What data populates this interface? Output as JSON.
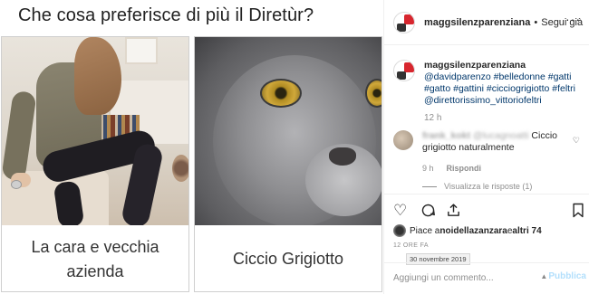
{
  "post": {
    "question": "Che cosa preferisce di più il Diretùr?",
    "options": [
      {
        "label": "La cara e vecchia azienda"
      },
      {
        "label": "Ciccio Grigiotto"
      }
    ]
  },
  "panel": {
    "header": {
      "username": "maggsilenzparenziana",
      "separator": "•",
      "follow_status": "Segui già",
      "more_icon": "more-horizontal-icon"
    },
    "caption": {
      "username": "maggsilenzparenziana",
      "tags": "@davidparenzo #belledonne #gatti #gatto #gattini #cicciogrigiotto #feltri @direttorissimo_vittoriofeltri",
      "time": "12 h"
    },
    "comment": {
      "username": "frank_kokt",
      "mention": "@lucagnoatti",
      "text": "Ciccio grigiotto naturalmente",
      "time": "9 h",
      "reply_label": "Rispondi",
      "view_replies": "Visualizza le risposte (1)",
      "like_icon": "heart-outline-icon"
    },
    "actions": {
      "like_icon": "heart-outline-icon",
      "comment_icon": "comment-bubble-icon",
      "share_icon": "share-icon",
      "save_icon": "bookmark-icon"
    },
    "likes": {
      "prefix": "Piace a ",
      "user": "noidellazanzara",
      "middle": " e ",
      "others": "altri 74"
    },
    "posted_time": "12 ORE FA",
    "tooltip_date": "30 novembre 2019",
    "add_comment": {
      "placeholder": "Aggiungi un commento...",
      "publish_label": "Pubblica"
    }
  }
}
